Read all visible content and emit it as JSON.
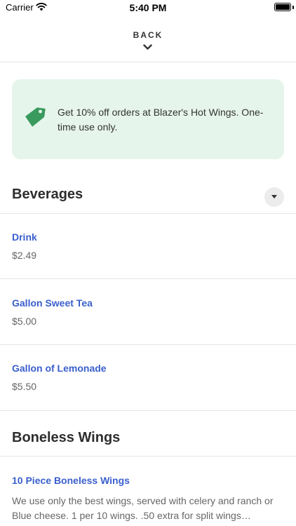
{
  "status_bar": {
    "carrier": "Carrier",
    "time": "5:40 PM"
  },
  "nav": {
    "back_label": "BACK"
  },
  "promo": {
    "text": "Get 10% off orders at Blazer's Hot Wings. One-time use only.",
    "accent_color": "#3a9a5e",
    "background_color": "#e6f5ec"
  },
  "sections": [
    {
      "title": "Beverages",
      "items": [
        {
          "name": "Drink",
          "price": "$2.49"
        },
        {
          "name": "Gallon Sweet Tea",
          "price": "$5.00"
        },
        {
          "name": "Gallon of Lemonade",
          "price": "$5.50"
        }
      ]
    },
    {
      "title": "Boneless Wings",
      "items": [
        {
          "name": "10 Piece Boneless Wings",
          "description": "We use only the best wings, served with celery and ranch or Blue cheese. 1 per 10 wings. .50 extra for split wings…"
        }
      ]
    }
  ],
  "colors": {
    "link": "#3a5fcd",
    "divider": "#e5e5e5"
  }
}
